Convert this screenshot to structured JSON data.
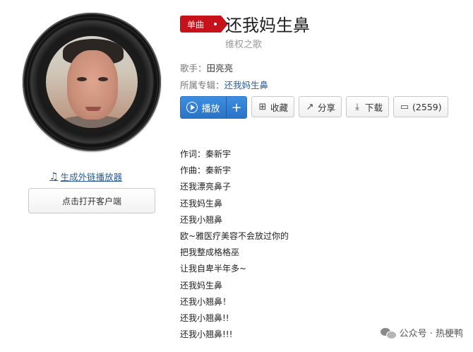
{
  "song": {
    "tag": "单曲",
    "title": "还我妈生鼻",
    "subtitle": "维权之歌",
    "singer_label": "歌手：",
    "singer": "田亮亮",
    "album_label": "所属专辑：",
    "album": "还我妈生鼻"
  },
  "toolbar": {
    "play_label": "播放",
    "add_label": "+",
    "collect_label": "收藏",
    "share_label": "分享",
    "download_label": "下载",
    "comment_label": "(2559)"
  },
  "left": {
    "ext_player_label": "生成外链播放器",
    "client_button_label": "点击打开客户端"
  },
  "lyrics": [
    "作词：秦新宇",
    "作曲：秦新宇",
    "还我漂亮鼻子",
    "还我妈生鼻",
    "还我小翘鼻",
    "欧~雅医疗美容不会放过你的",
    "把我整成格格巫",
    "让我自卑半年多~",
    "还我妈生鼻",
    "还我小翘鼻！",
    "还我小翘鼻!!",
    "还我小翘鼻!!!"
  ],
  "watermark": "公众号 · 热梗鸭",
  "colors": {
    "tag_red": "#c8121b",
    "play_blue": "#2a73c7",
    "link_blue": "#2a5c9a"
  },
  "icons": {
    "play": "play-circle-icon",
    "collect": "folder-plus-icon",
    "share": "share-icon",
    "download": "download-icon",
    "comment": "comment-icon",
    "music_note": "music-note-icon"
  }
}
